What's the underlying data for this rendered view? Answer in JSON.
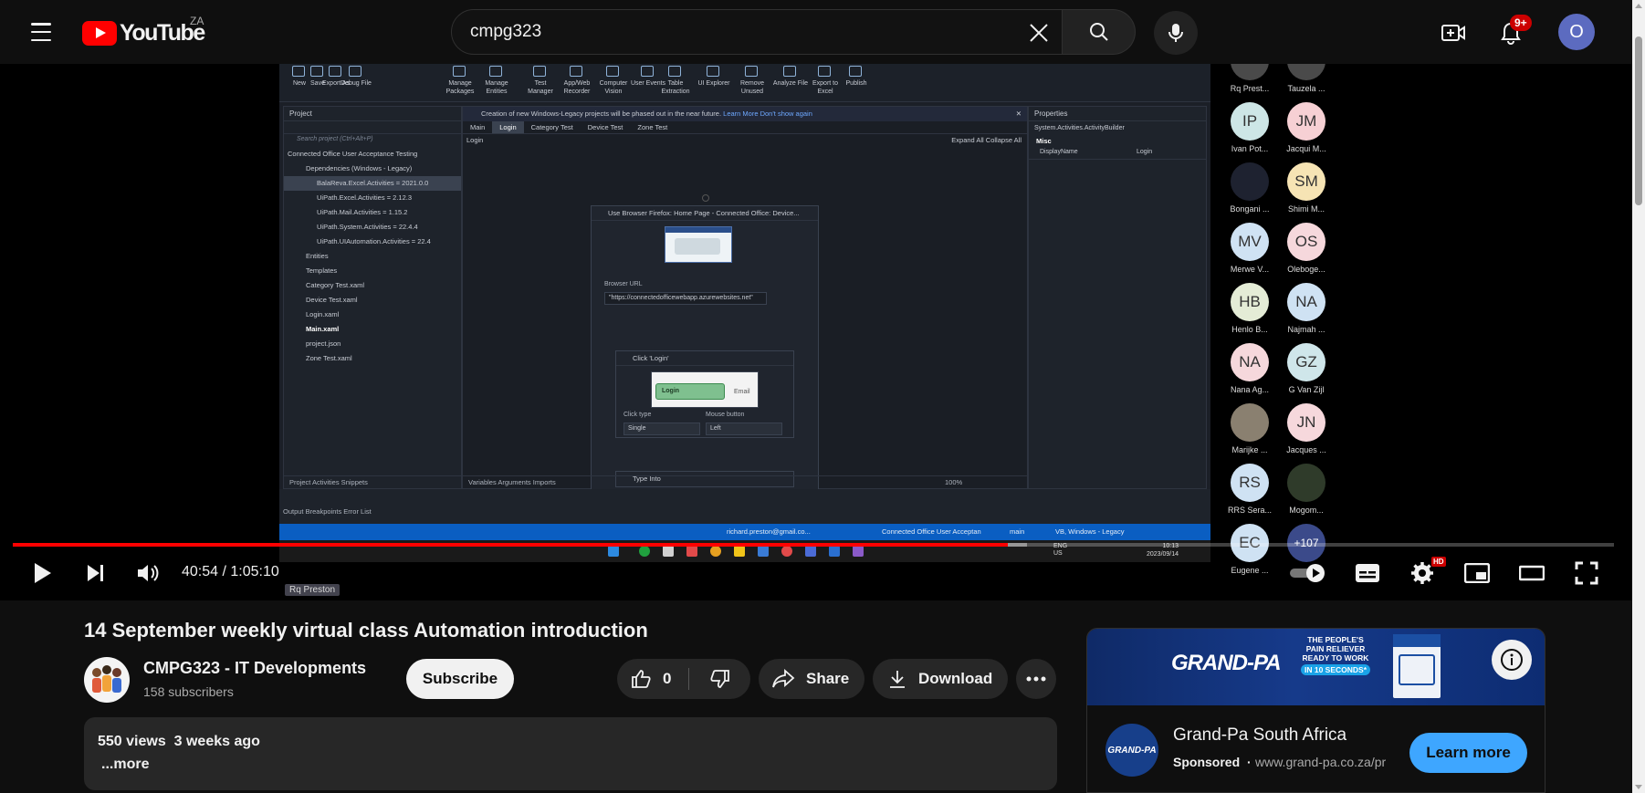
{
  "header": {
    "logo_text": "YouTube",
    "region": "ZA",
    "search_value": "cmpg323",
    "notification_count": "9+",
    "avatar_letter": "O"
  },
  "player": {
    "progress_fraction": 0.6216,
    "current_time": "40:54",
    "duration": "1:05:10",
    "time_display": "40:54 / 1:05:10",
    "hd_badge": "HD",
    "name_tag": "Rq Preston"
  },
  "video_content": {
    "ribbon": [
      {
        "label": "New"
      },
      {
        "label": "Save"
      },
      {
        "label": "Export As"
      },
      {
        "label": "Debug File"
      },
      {
        "label": "Manage Packages"
      },
      {
        "label": "Manage Entities"
      },
      {
        "label": "Test Manager"
      },
      {
        "label": "App/Web Recorder"
      },
      {
        "label": "Computer Vision"
      },
      {
        "label": "User Events"
      },
      {
        "label": "Table Extraction"
      },
      {
        "label": "UI Explorer"
      },
      {
        "label": "Remove Unused"
      },
      {
        "label": "Analyze File"
      },
      {
        "label": "Export to Excel"
      },
      {
        "label": "Publish"
      }
    ],
    "project_panel_title": "Project",
    "search_project": "Search project (Ctrl+Alt+P)",
    "tree": [
      {
        "label": "Connected Office User Acceptance Testing",
        "sel": false,
        "bold": false
      },
      {
        "label": "Dependencies (Windows - Legacy)",
        "sel": false,
        "bold": false
      },
      {
        "label": "BalaReva.Excel.Activities = 2021.0.0",
        "sel": true,
        "bold": false
      },
      {
        "label": "UiPath.Excel.Activities = 2.12.3",
        "sel": false,
        "bold": false
      },
      {
        "label": "UiPath.Mail.Activities = 1.15.2",
        "sel": false,
        "bold": false
      },
      {
        "label": "UiPath.System.Activities = 22.4.4",
        "sel": false,
        "bold": false
      },
      {
        "label": "UiPath.UIAutomation.Activities = 22.4",
        "sel": false,
        "bold": false
      },
      {
        "label": "Entities",
        "sel": false,
        "bold": false
      },
      {
        "label": "Templates",
        "sel": false,
        "bold": false
      },
      {
        "label": "Category Test.xaml",
        "sel": false,
        "bold": false
      },
      {
        "label": "Device Test.xaml",
        "sel": false,
        "bold": false
      },
      {
        "label": "Login.xaml",
        "sel": false,
        "bold": false
      },
      {
        "label": "Main.xaml",
        "sel": false,
        "bold": true
      },
      {
        "label": "project.json",
        "sel": false,
        "bold": false
      },
      {
        "label": "Zone Test.xaml",
        "sel": false,
        "bold": false
      }
    ],
    "left_bottom_tabs": "Project    Activities    Snippets",
    "output_tabs": "Output  Breakpoints  Error List",
    "info_bar": "Creation of new Windows-Legacy projects will be phased out in the near future.",
    "info_links": "Learn More   Don't show again",
    "doc_tabs": [
      {
        "label": "Main",
        "on": false
      },
      {
        "label": "Login",
        "on": true
      },
      {
        "label": "Category Test",
        "on": false
      },
      {
        "label": "Device Test",
        "on": false
      },
      {
        "label": "Zone Test",
        "on": false
      }
    ],
    "sequence_name": "Login",
    "expand_collapse": "Expand All  Collapse All",
    "browser_activity_title": "Use Browser Firefox: Home Page - Connected Office: Device...",
    "browser_url_label": "Browser URL",
    "browser_url_value": "\"https://connectedofficewebapp.azurewebsites.net\"",
    "click_activity_title": "Click 'Login'",
    "click_preview_button": "Login",
    "click_preview_email": "Email",
    "click_type_label": "Click type",
    "click_type_value": "Single",
    "mouse_button_label": "Mouse button",
    "mouse_button_value": "Left",
    "type_activity_title": "Type Into",
    "designer_bottom": "Variables   Arguments   Imports",
    "zoom": "100%",
    "properties_title": "Properties",
    "properties_type": "System.Activities.ActivityBuilder",
    "properties_section": "Misc",
    "properties_key": "DisplayName",
    "properties_value": "Login",
    "status_account": "richard.preston@gmail.co...",
    "status_project": "Connected Office User Acceptan",
    "status_branch": "main",
    "status_profile": "VB, Windows - Legacy",
    "taskbar_lang": "ENG US",
    "taskbar_time": "10:13",
    "taskbar_date": "2023/09/14"
  },
  "participants": [
    {
      "initials": "",
      "name": "Rq Prest...",
      "color": "#4a4a4a"
    },
    {
      "initials": "",
      "name": "Tauzela ...",
      "color": "#4a4a4a"
    },
    {
      "initials": "IP",
      "name": "Ivan Pot...",
      "color": "#cde6e6"
    },
    {
      "initials": "JM",
      "name": "Jacqui M...",
      "color": "#f6d0d4"
    },
    {
      "initials": "",
      "name": "Bongani ...",
      "color": "#1e2230"
    },
    {
      "initials": "SM",
      "name": "Shimi M...",
      "color": "#f6e4b4"
    },
    {
      "initials": "MV",
      "name": "Merwe V...",
      "color": "#cfe2f3"
    },
    {
      "initials": "OS",
      "name": "Olebogе...",
      "color": "#f6d8dc"
    },
    {
      "initials": "HB",
      "name": "Henlo B...",
      "color": "#e4ecd6"
    },
    {
      "initials": "NA",
      "name": "Najmah ...",
      "color": "#cfe2f3"
    },
    {
      "initials": "NA",
      "name": "Nana Ag...",
      "color": "#f6d8dc"
    },
    {
      "initials": "GZ",
      "name": "G Van Zijl",
      "color": "#cfe6ea"
    },
    {
      "initials": "",
      "name": "Marijke ...",
      "color": "#8a8070"
    },
    {
      "initials": "JN",
      "name": "Jacques ...",
      "color": "#f6d8dc"
    },
    {
      "initials": "RS",
      "name": "RRS Sera...",
      "color": "#cfe2f3"
    },
    {
      "initials": "",
      "name": "Mogom...",
      "color": "#2f3b2a"
    },
    {
      "initials": "EC",
      "name": "Eugene ...",
      "color": "#cfe2f3"
    },
    {
      "initials": "+107",
      "name": "",
      "color": "#3b4a8a"
    }
  ],
  "video": {
    "title": "14 September weekly virtual class Automation introduction",
    "channel": "CMPG323 - IT Developments",
    "subscribers": "158 subscribers",
    "subscribe_label": "Subscribe",
    "like_count": "0",
    "share_label": "Share",
    "download_label": "Download",
    "views": "550 views",
    "uploaded": "3 weeks ago",
    "more_label": "...more"
  },
  "ad": {
    "brand": "GRAND-PA",
    "slogan_line1": "THE PEOPLE'S",
    "slogan_line2": "PAIN RELIEVER",
    "slogan_line3": "READY TO WORK",
    "slogan_line4": "IN 10 SECONDS*",
    "advertiser": "Grand-Pa South Africa",
    "sponsored": "Sponsored",
    "separator": "·",
    "domain": "www.grand-pa.co.za/pr",
    "cta": "Learn more"
  },
  "colors": {
    "accent_red": "#ff0000",
    "cta_blue": "#3ea6ff",
    "status_blue": "#0a5ec2"
  }
}
